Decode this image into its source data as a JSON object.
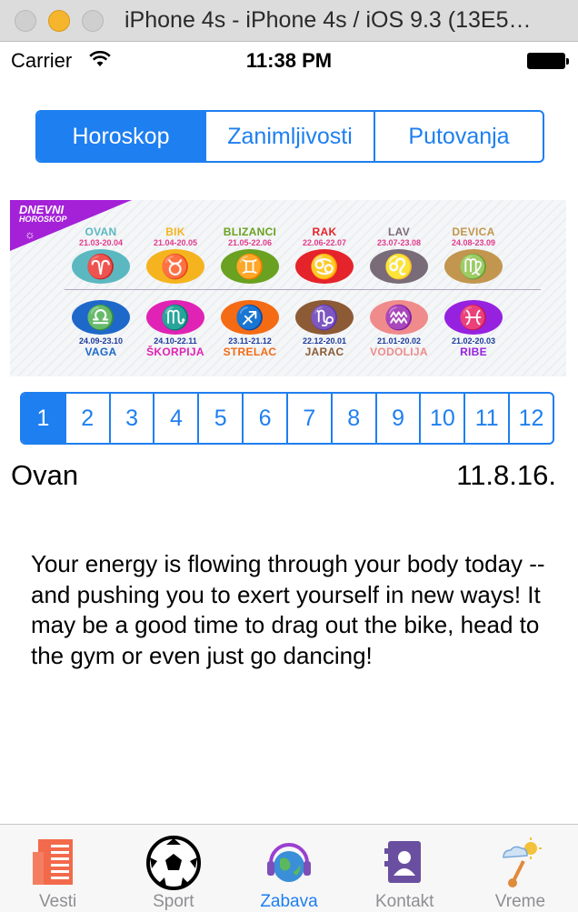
{
  "window": {
    "title": "iPhone 4s - iPhone 4s / iOS 9.3 (13E5…"
  },
  "status": {
    "carrier": "Carrier",
    "time": "11:38 PM"
  },
  "segments": [
    {
      "label": "Horoskop",
      "active": true
    },
    {
      "label": "Zanimljivosti",
      "active": false
    },
    {
      "label": "Putovanja",
      "active": false
    }
  ],
  "banner": {
    "flag_line1": "DNEVNI",
    "flag_line2": "HOROSKOP",
    "top_row": [
      {
        "name": "OVAN",
        "date": "21.03-20.04",
        "color": "#5bb8c1",
        "symbol": "♈"
      },
      {
        "name": "BIK",
        "date": "21.04-20.05",
        "color": "#f5b41f",
        "symbol": "♉"
      },
      {
        "name": "BLIZANCI",
        "date": "21.05-22.06",
        "color": "#6aa120",
        "symbol": "♊"
      },
      {
        "name": "RAK",
        "date": "22.06-22.07",
        "color": "#e5232b",
        "symbol": "♋"
      },
      {
        "name": "LAV",
        "date": "23.07-23.08",
        "color": "#7a6b78",
        "symbol": "♌"
      },
      {
        "name": "DEVICA",
        "date": "24.08-23.09",
        "color": "#c2964e",
        "symbol": "♍"
      }
    ],
    "bottom_row": [
      {
        "name": "VAGA",
        "date": "24.09-23.10",
        "color": "#1e68c9",
        "symbol": "♎"
      },
      {
        "name": "ŠKORPIJA",
        "date": "24.10-22.11",
        "color": "#e023b4",
        "symbol": "♏"
      },
      {
        "name": "STRELAC",
        "date": "23.11-21.12",
        "color": "#f46b14",
        "symbol": "♐"
      },
      {
        "name": "JARAC",
        "date": "22.12-20.01",
        "color": "#8c5a35",
        "symbol": "♑"
      },
      {
        "name": "VODOLIJA",
        "date": "21.01-20.02",
        "color": "#f08b8b",
        "symbol": "♒"
      },
      {
        "name": "RIBE",
        "date": "21.02-20.03",
        "color": "#9622e0",
        "symbol": "♓"
      }
    ]
  },
  "pages": [
    "1",
    "2",
    "3",
    "4",
    "5",
    "6",
    "7",
    "8",
    "9",
    "10",
    "11",
    "12"
  ],
  "selected_page": "1",
  "sign": {
    "name": "Ovan",
    "date": "11.8.16."
  },
  "reading": "Your energy is flowing through your body today -- and pushing you to exert yourself in new ways! It may be a good time to drag out the bike, head to the gym or even just go dancing!",
  "tabs": [
    {
      "label": "Vesti",
      "icon": "newspaper-icon",
      "active": false
    },
    {
      "label": "Sport",
      "icon": "soccer-ball-icon",
      "active": false
    },
    {
      "label": "Zabava",
      "icon": "globe-headphones-icon",
      "active": true
    },
    {
      "label": "Kontakt",
      "icon": "contact-card-icon",
      "active": false
    },
    {
      "label": "Vreme",
      "icon": "weather-icon",
      "active": false
    }
  ],
  "colors": {
    "accent": "#1e7ff0",
    "tab_inactive": "#8e8e93"
  }
}
